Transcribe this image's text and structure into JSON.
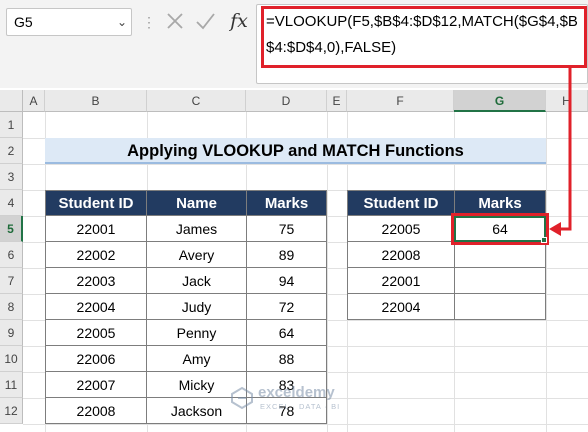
{
  "name_box": {
    "value": "G5"
  },
  "formula_bar": {
    "fx_label": "fx",
    "formula": "=VLOOKUP(F5,$B$4:$D$12,MATCH($G$4,$B$4:$D$4,0),FALSE)"
  },
  "columns": [
    "A",
    "B",
    "C",
    "D",
    "E",
    "F",
    "G",
    "H"
  ],
  "rows": [
    "1",
    "2",
    "3",
    "4",
    "5",
    "6",
    "7",
    "8",
    "9",
    "10",
    "11",
    "12"
  ],
  "selected": {
    "column": "G",
    "row": "5"
  },
  "title": "Applying VLOOKUP and MATCH Functions",
  "main_table": {
    "headers": [
      "Student ID",
      "Name",
      "Marks"
    ],
    "rows": [
      [
        "22001",
        "James",
        "75"
      ],
      [
        "22002",
        "Avery",
        "89"
      ],
      [
        "22003",
        "Jack",
        "94"
      ],
      [
        "22004",
        "Judy",
        "72"
      ],
      [
        "22005",
        "Penny",
        "64"
      ],
      [
        "22006",
        "Amy",
        "88"
      ],
      [
        "22007",
        "Micky",
        "83"
      ],
      [
        "22008",
        "Jackson",
        "78"
      ]
    ]
  },
  "lookup_table": {
    "headers": [
      "Student ID",
      "Marks"
    ],
    "rows": [
      [
        "22005",
        "64"
      ],
      [
        "22008",
        ""
      ],
      [
        "22001",
        ""
      ],
      [
        "22004",
        ""
      ]
    ]
  },
  "watermark": {
    "name": "exceldemy",
    "tagline": "EXCEL · DATA · BI"
  },
  "colors": {
    "table_header": "#223b61",
    "title_fill": "#dde9f6",
    "highlight": "#e0212a",
    "selection": "#217346"
  }
}
